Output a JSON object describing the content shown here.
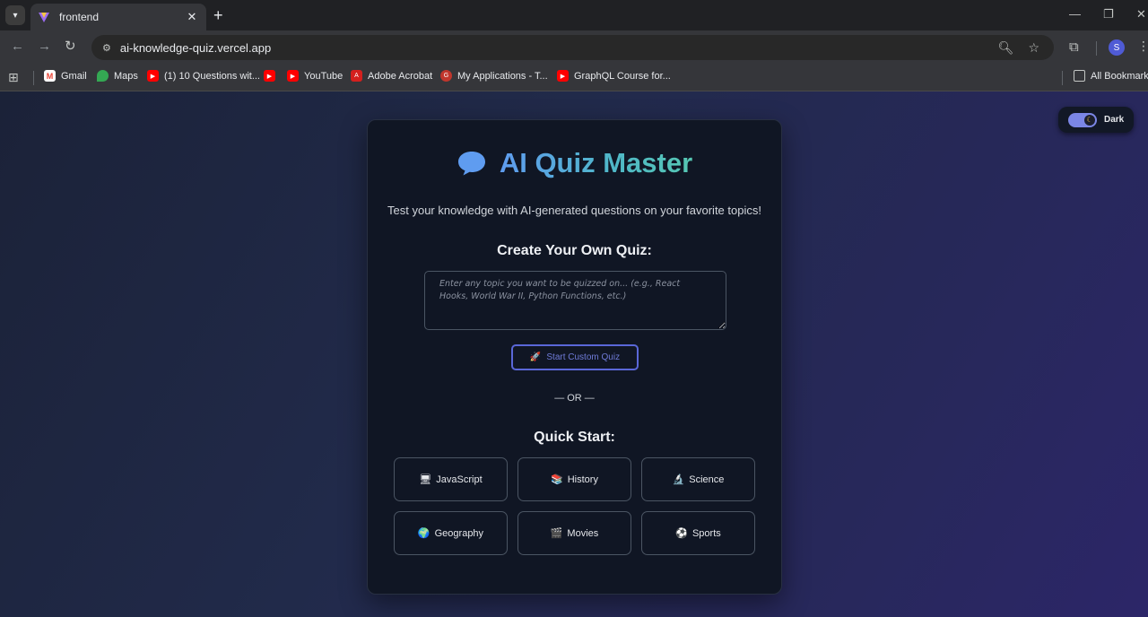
{
  "browser": {
    "tab_title": "frontend",
    "url": "ai-knowledge-quiz.vercel.app",
    "new_tab": "+",
    "tab_close": "✕",
    "bookmarks": [
      {
        "label": "Gmail",
        "icon": "gmail-icon"
      },
      {
        "label": "Maps",
        "icon": "maps-icon"
      },
      {
        "label": "(1) 10 Questions wit...",
        "icon": "youtube-icon"
      },
      {
        "label": "",
        "icon": "youtube-icon"
      },
      {
        "label": "YouTube",
        "icon": "youtube-icon"
      },
      {
        "label": "Adobe Acrobat",
        "icon": "acrobat-icon"
      },
      {
        "label": "My Applications - T...",
        "icon": "app-icon"
      },
      {
        "label": "GraphQL Course for...",
        "icon": "youtube-icon"
      }
    ],
    "all_bookmarks": "All Bookmarks",
    "avatar_letter": "S"
  },
  "theme_toggle": {
    "label": "Dark"
  },
  "card": {
    "title": "AI Quiz Master",
    "subtitle": "Test your knowledge with AI-generated questions on your favorite topics!",
    "create_heading": "Create Your Own Quiz:",
    "topic_placeholder": "Enter any topic you want to be quizzed on... (e.g., React Hooks, World War II, Python Functions, etc.)",
    "start_button": "Start Custom Quiz",
    "or_separator": "— OR —",
    "quick_start_heading": "Quick Start:",
    "quick_topics": [
      {
        "label": "JavaScript",
        "icon": "🖥"
      },
      {
        "label": "History",
        "icon": "📚"
      },
      {
        "label": "Science",
        "icon": "🔬"
      },
      {
        "label": "Geography",
        "icon": "🌍"
      },
      {
        "label": "Movies",
        "icon": "🎬"
      },
      {
        "label": "Sports",
        "icon": "⚽"
      }
    ]
  },
  "colors": {
    "accent": "#5a67d8",
    "title_gradient_start": "#5f9cf0",
    "title_gradient_end": "#56c7b3",
    "card_bg": "#101624"
  }
}
